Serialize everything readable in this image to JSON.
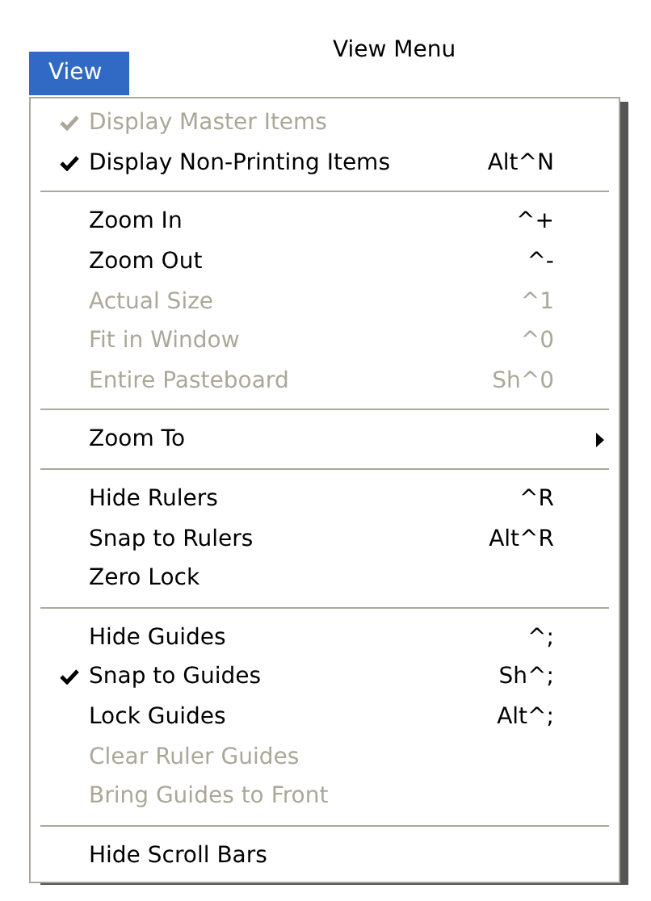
{
  "title": "View Menu",
  "menu_button": {
    "label": "View",
    "selected": true
  },
  "sections": [
    {
      "items": [
        {
          "kind": "item",
          "label": "Display Master Items",
          "checked": true,
          "disabled": true
        },
        {
          "kind": "item",
          "label": "Display Non-Printing Items",
          "shortcut": "Alt^N",
          "checked": true,
          "disabled": false
        }
      ]
    },
    {
      "items": [
        {
          "kind": "item",
          "label": "Zoom In",
          "shortcut": "^+",
          "checked": false,
          "disabled": false
        },
        {
          "kind": "item",
          "label": "Zoom Out",
          "shortcut": "^-",
          "checked": false,
          "disabled": false
        },
        {
          "kind": "item",
          "label": "Actual Size",
          "shortcut": "^1",
          "checked": false,
          "disabled": true
        },
        {
          "kind": "item",
          "label": "Fit in Window",
          "shortcut": "^0",
          "checked": false,
          "disabled": true
        },
        {
          "kind": "item",
          "label": "Entire Pasteboard",
          "shortcut": "Sh^0",
          "checked": false,
          "disabled": true
        }
      ]
    },
    {
      "items": [
        {
          "kind": "submenu",
          "label": "Zoom To",
          "checked": false,
          "disabled": false
        }
      ]
    },
    {
      "items": [
        {
          "kind": "item",
          "label": "Hide Rulers",
          "shortcut": "^R",
          "checked": false,
          "disabled": false
        },
        {
          "kind": "item",
          "label": "Snap to Rulers",
          "shortcut": "Alt^R",
          "checked": false,
          "disabled": false
        },
        {
          "kind": "item",
          "label": "Zero Lock",
          "checked": false,
          "disabled": false
        }
      ]
    },
    {
      "items": [
        {
          "kind": "item",
          "label": "Hide Guides",
          "shortcut": "^;",
          "checked": false,
          "disabled": false
        },
        {
          "kind": "item",
          "label": "Snap to Guides",
          "shortcut": "Sh^;",
          "checked": true,
          "disabled": false
        },
        {
          "kind": "item",
          "label": "Lock Guides",
          "shortcut": "Alt^;",
          "checked": false,
          "disabled": false
        },
        {
          "kind": "item",
          "label": "Clear Ruler Guides",
          "checked": false,
          "disabled": true
        },
        {
          "kind": "item",
          "label": "Bring Guides to Front",
          "checked": false,
          "disabled": true
        }
      ]
    },
    {
      "items": [
        {
          "kind": "item",
          "label": "Hide Scroll Bars",
          "checked": false,
          "disabled": false
        }
      ]
    }
  ]
}
